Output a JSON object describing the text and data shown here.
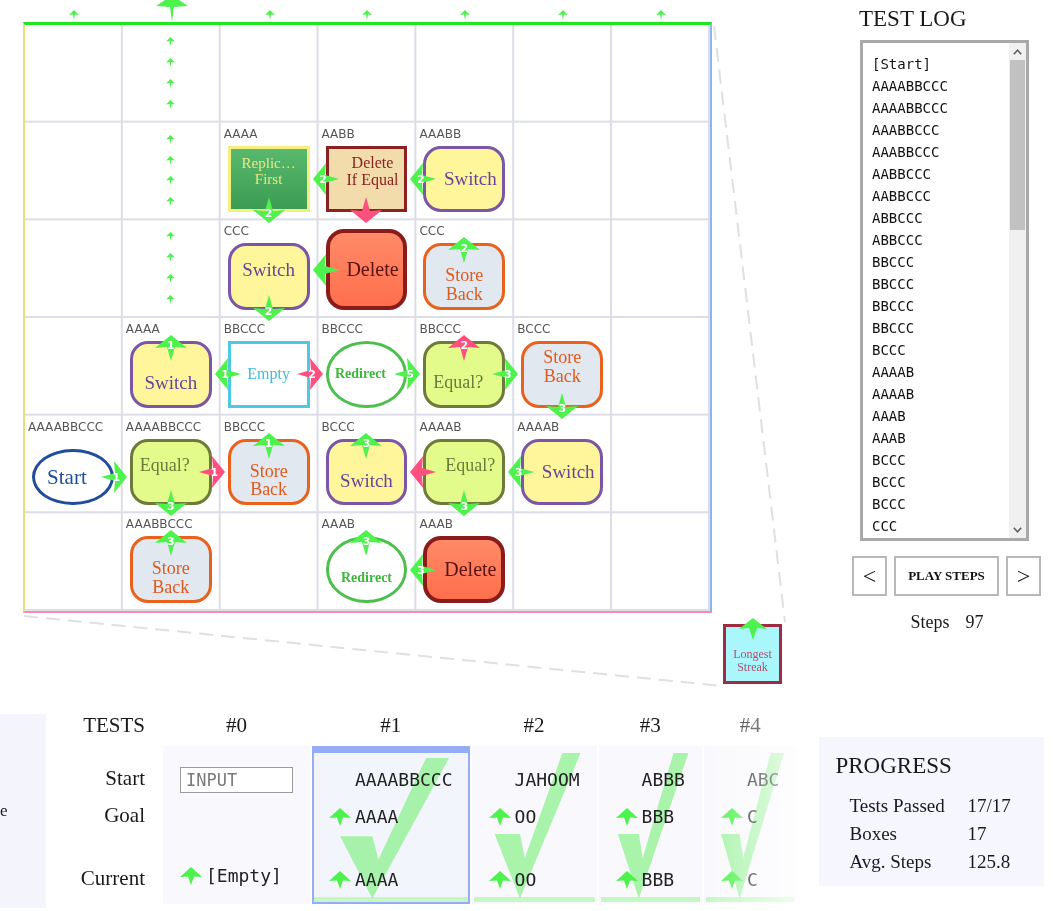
{
  "board": {
    "exits": [
      {
        "active": false
      },
      {
        "active": true
      },
      {
        "active": false
      },
      {
        "active": false
      },
      {
        "active": false
      },
      {
        "active": false
      },
      {
        "active": false
      }
    ],
    "rows": [
      [
        {},
        {
          "trail": true
        },
        {},
        {},
        {},
        {},
        {}
      ],
      [
        {},
        {
          "trail": true
        },
        {
          "tape": "AAAA",
          "node": {
            "kind": "replicate",
            "text": "Replic…\nFirst",
            "arrows": [
              {
                "kind": "down",
                "color": "#4df24d",
                "label": "2"
              }
            ]
          }
        },
        {
          "tape": "AABB",
          "node": {
            "kind": "delete_if_equal",
            "text": "Delete\nIf Equal",
            "arrows": [
              {
                "kind": "left",
                "color": "#4df24d",
                "label": "2"
              },
              {
                "kind": "down",
                "color": "#ff4f7e"
              }
            ]
          }
        },
        {
          "tape": "AAABB",
          "node": {
            "kind": "switch",
            "text": "Switch",
            "arrows": [
              {
                "kind": "left",
                "color": "#4df24d",
                "label": "2"
              }
            ]
          }
        },
        {},
        {}
      ],
      [
        {},
        {
          "trail": true
        },
        {
          "tape": "CCC",
          "node": {
            "kind": "switch",
            "text": "Switch",
            "arrows": [
              {
                "kind": "down",
                "color": "#4df24d",
                "label": "2"
              }
            ]
          }
        },
        {
          "node": {
            "kind": "delete",
            "text": "Delete",
            "arrows": [
              {
                "kind": "left",
                "color": "#4df24d"
              }
            ]
          }
        },
        {
          "tape": "CCC",
          "node": {
            "kind": "store_back",
            "text": "Store\nBack",
            "arrows": [
              {
                "kind": "up",
                "color": "#4df24d",
                "label": "2"
              }
            ]
          }
        },
        {},
        {}
      ],
      [
        {},
        {
          "tape": "AAAA",
          "node": {
            "kind": "switch",
            "text": "Switch",
            "arrows": [
              {
                "kind": "up",
                "color": "#4df24d",
                "label": "1"
              }
            ]
          }
        },
        {
          "tape": "BBCCC",
          "node": {
            "kind": "empty",
            "text": "Empty",
            "arrows": [
              {
                "kind": "left",
                "color": "#4df24d",
                "label": "1"
              },
              {
                "kind": "right",
                "color": "#ff4f7e",
                "label": "2"
              }
            ]
          }
        },
        {
          "tape": "BBCCC",
          "node": {
            "kind": "redirect",
            "text": "Redirect",
            "arrows": [
              {
                "kind": "right",
                "color": "#4df24d",
                "label": "5"
              }
            ]
          }
        },
        {
          "tape": "BBCCC",
          "node": {
            "kind": "equal",
            "text": "Equal?",
            "arrows": [
              {
                "kind": "up",
                "color": "#ff4f7e",
                "label": "2"
              },
              {
                "kind": "right",
                "color": "#4df24d",
                "label": "3"
              }
            ]
          }
        },
        {
          "tape": "BCCC",
          "node": {
            "kind": "store_back",
            "text": "Store\nBack",
            "arrows": [
              {
                "kind": "down",
                "color": "#4df24d",
                "label": "3"
              }
            ]
          }
        },
        {}
      ],
      [
        {
          "tape": "AAAABBCCC",
          "node": {
            "kind": "start",
            "text": "Start",
            "arrows": [
              {
                "kind": "right",
                "color": "#4df24d",
                "label": "1"
              }
            ]
          }
        },
        {
          "tape": "AAAABBCCC",
          "node": {
            "kind": "equal",
            "text": "Equal?",
            "arrows": [
              {
                "kind": "right",
                "color": "#ff4f7e",
                "label": "1"
              },
              {
                "kind": "down",
                "color": "#4df24d",
                "label": "3"
              }
            ]
          }
        },
        {
          "tape": "BBCCC",
          "node": {
            "kind": "store_back",
            "text": "Store\nBack",
            "arrows": [
              {
                "kind": "up",
                "color": "#4df24d",
                "label": "1"
              }
            ]
          }
        },
        {
          "tape": "BCCC",
          "node": {
            "kind": "switch",
            "text": "Switch",
            "arrows": [
              {
                "kind": "up",
                "color": "#4df24d",
                "label": "3"
              }
            ]
          }
        },
        {
          "tape": "AAAAB",
          "node": {
            "kind": "equal",
            "text": "Equal?",
            "arrows": [
              {
                "kind": "left",
                "color": "#ff4f7e"
              },
              {
                "kind": "down",
                "color": "#4df24d",
                "label": "3"
              }
            ]
          }
        },
        {
          "tape": "AAAAB",
          "node": {
            "kind": "switch",
            "text": "Switch",
            "arrows": [
              {
                "kind": "left",
                "color": "#4df24d",
                "label": "3"
              }
            ]
          }
        },
        {}
      ],
      [
        {},
        {
          "tape": "AAABBCCC",
          "node": {
            "kind": "store_back",
            "text": "Store\nBack",
            "arrows": [
              {
                "kind": "up",
                "color": "#4df24d",
                "label": "3"
              }
            ]
          }
        },
        {},
        {
          "tape": "AAAB",
          "node": {
            "kind": "redirect",
            "text": "Redirect",
            "arrows": [
              {
                "kind": "up",
                "color": "#4df24d",
                "label": "3"
              }
            ]
          }
        },
        {
          "tape": "AAAB",
          "node": {
            "kind": "delete",
            "text": "Delete",
            "arrows": [
              {
                "kind": "left",
                "color": "#4df24d",
                "label": "3"
              }
            ]
          }
        },
        {},
        {}
      ]
    ]
  },
  "test_log": {
    "title": "TEST LOG",
    "entries": [
      "[Start]",
      "AAAABBCCC",
      "AAAABBCCC",
      "AAABBCCC",
      "AAABBCCC",
      "AABBCCC",
      "AABBCCC",
      "ABBCCC",
      "ABBCCC",
      "BBCCC",
      "BBCCC",
      "BBCCC",
      "BBCCC",
      "BCCC",
      "AAAAB",
      "AAAAB",
      "AAAB",
      "AAAB",
      "BCCC",
      "BCCC",
      "BCCC",
      "CCC"
    ],
    "controls": [
      {
        "kind": "previous",
        "label": "<"
      },
      {
        "kind": "play",
        "label": "PLAY STEPS"
      },
      {
        "kind": "next",
        "label": ">"
      }
    ],
    "steps": {
      "label": "Steps",
      "value": "97"
    }
  },
  "zoom_source": {
    "kind": "streak",
    "text": "Longest\nStreak",
    "arrows": [
      {
        "kind": "up",
        "color": "#4df24d"
      }
    ]
  },
  "side_panel": {
    "text": "e"
  },
  "tests": {
    "title": "TESTS",
    "row_labels": [
      "Start",
      "Goal",
      "Current"
    ],
    "columns": [
      {
        "label": "#0",
        "input": {
          "placeholder": "INPUT"
        },
        "current": "[Empty]",
        "passed": false,
        "selected": false
      },
      {
        "label": "#1",
        "start": "AAAABBCCC",
        "goal": "AAAA",
        "current": "AAAA",
        "passed": true,
        "selected": true
      },
      {
        "label": "#2",
        "start": "JAHOOM",
        "goal": "OO",
        "current": "OO",
        "passed": true,
        "selected": false
      },
      {
        "label": "#3",
        "start": "ABBB",
        "goal": "BBB",
        "current": "BBB",
        "passed": true,
        "selected": false
      },
      {
        "label": "#4",
        "start": "ABC",
        "goal": "C",
        "current": "C",
        "passed": true,
        "selected": false
      }
    ]
  },
  "progress": {
    "title": "PROGRESS",
    "stats": [
      {
        "label": "Tests Passed",
        "value": "17/17"
      },
      {
        "label": "Boxes",
        "value": "17"
      },
      {
        "label": "Avg. Steps",
        "value": "125.8"
      }
    ]
  }
}
